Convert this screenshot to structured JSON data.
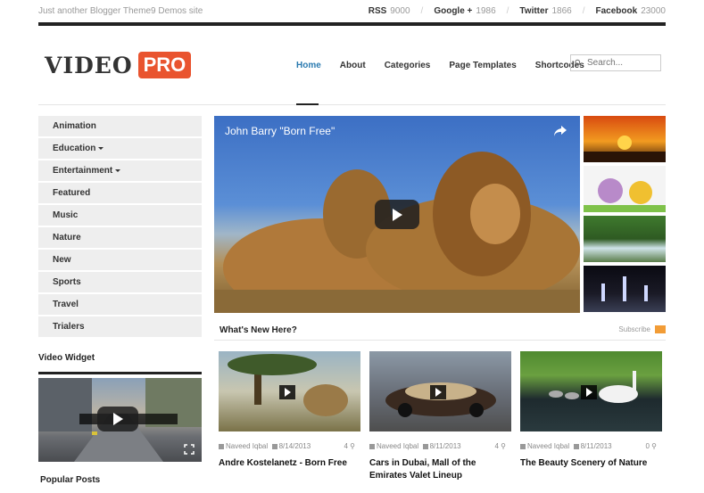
{
  "topbar": {
    "tagline": "Just another Blogger Theme9 Demos site",
    "socials": [
      {
        "name": "RSS",
        "count": "9000"
      },
      {
        "name": "Google +",
        "count": "1986"
      },
      {
        "name": "Twitter",
        "count": "1866"
      },
      {
        "name": "Facebook",
        "count": "23000"
      }
    ]
  },
  "logo": {
    "word": "VIDEO",
    "badge": "PRO"
  },
  "nav": [
    "Home",
    "About",
    "Categories",
    "Page Templates",
    "Shortcodes"
  ],
  "search": {
    "placeholder": "Search..."
  },
  "sidebar": {
    "items": [
      {
        "label": "Animation"
      },
      {
        "label": "Education"
      },
      {
        "label": "Entertainment"
      },
      {
        "label": "Featured"
      },
      {
        "label": "Music"
      },
      {
        "label": "Nature"
      },
      {
        "label": "New"
      },
      {
        "label": "Sports"
      },
      {
        "label": "Travel"
      },
      {
        "label": "Trialers"
      }
    ],
    "widget_title": "Video Widget",
    "popular_title": "Popular Posts"
  },
  "hero": {
    "title": "John Barry \"Born Free\""
  },
  "whats_new": {
    "title": "What's New Here?",
    "subscribe": "Subscribe"
  },
  "posts": [
    {
      "author": "Naveed Iqbal",
      "date": "8/14/2013",
      "comments": "4",
      "title": "Andre Kostelanetz - Born Free"
    },
    {
      "author": "Naveed Iqbal",
      "date": "8/11/2013",
      "comments": "4",
      "title": "Cars in Dubai, Mall of the Emirates Valet Lineup"
    },
    {
      "author": "Naveed Iqbal",
      "date": "8/11/2013",
      "comments": "0",
      "title": "The Beauty Scenery of Nature"
    }
  ]
}
